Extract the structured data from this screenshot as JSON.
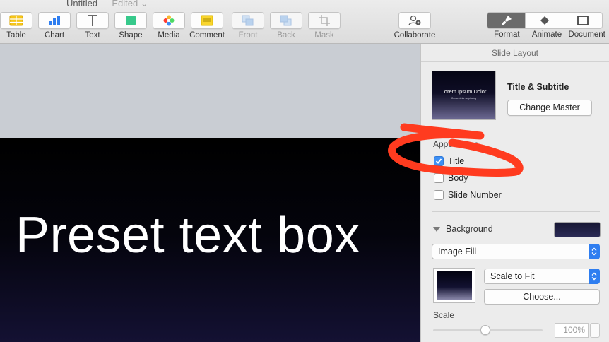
{
  "window": {
    "title": "Untitled",
    "edited": "— Edited"
  },
  "toolbar": {
    "tools": [
      {
        "label": "Table",
        "icon": "table-icon"
      },
      {
        "label": "Chart",
        "icon": "chart-icon"
      },
      {
        "label": "Text",
        "icon": "text-icon"
      },
      {
        "label": "Shape",
        "icon": "shape-icon"
      },
      {
        "label": "Media",
        "icon": "media-icon"
      },
      {
        "label": "Comment",
        "icon": "comment-icon"
      },
      {
        "label": "Front",
        "icon": "front-icon"
      },
      {
        "label": "Back",
        "icon": "back-icon"
      },
      {
        "label": "Mask",
        "icon": "mask-icon"
      }
    ],
    "collaborate": "Collaborate",
    "format": "Format",
    "animate": "Animate",
    "document": "Document"
  },
  "slide": {
    "text": "Preset text box"
  },
  "inspector": {
    "title": "Slide Layout",
    "thumbnail": {
      "title": "Lorem Ipsum Dolor",
      "subtitle": "Consectetur adipiscing"
    },
    "layout_name": "Title & Subtitle",
    "change_master": "Change Master",
    "appearance_label": "Appearance",
    "checkboxes": {
      "title": {
        "label": "Title",
        "checked": true
      },
      "body": {
        "label": "Body",
        "checked": false
      },
      "slide_number": {
        "label": "Slide Number",
        "checked": false
      }
    },
    "background_label": "Background",
    "background_color": "#1c1c3d",
    "fill_type": "Image Fill",
    "scale_mode": "Scale to Fit",
    "choose": "Choose...",
    "scale_label": "Scale",
    "scale_value": "100%"
  },
  "colors": {
    "accent": "#2f7ef0",
    "annotation": "#ff3b1f"
  }
}
